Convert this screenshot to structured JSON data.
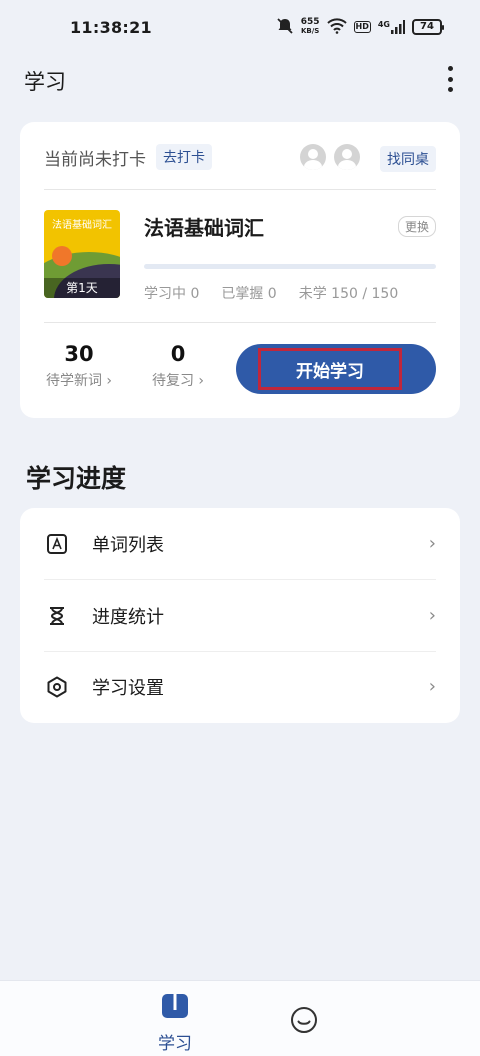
{
  "status_bar": {
    "time": "11:38:21",
    "net_speed_value": "655",
    "net_speed_unit": "KB/S",
    "hd_label": "HD",
    "network_label": "4G",
    "battery": "74"
  },
  "header": {
    "title": "学习"
  },
  "study_card": {
    "checkin_status": "当前尚未打卡",
    "checkin_button": "去打卡",
    "find_buddy_button": "找同桌",
    "book": {
      "cover_title": "法语基础词汇",
      "cover_day": "第1天",
      "name": "法语基础词汇",
      "change_button": "更换",
      "progress_fraction": 0.0
    },
    "stats": {
      "learning": "学习中 0",
      "mastered": "已掌握 0",
      "unlearned": "未学 150 / 150"
    },
    "new_words": {
      "value": "30",
      "label": "待学新词 ›"
    },
    "review_words": {
      "value": "0",
      "label": "待复习 ›"
    },
    "start_button": "开始学习"
  },
  "progress_section": {
    "title": "学习进度",
    "items": [
      {
        "label": "单词列表",
        "icon": "word-list-icon"
      },
      {
        "label": "进度统计",
        "icon": "hourglass-icon"
      },
      {
        "label": "学习设置",
        "icon": "settings-hexagon-icon"
      }
    ],
    "chevron": "›"
  },
  "tab_bar": {
    "tabs": [
      {
        "label": "学习",
        "icon": "book-icon",
        "active": true
      },
      {
        "label": "",
        "icon": "smile-icon",
        "active": false
      }
    ]
  },
  "colors": {
    "accent": "#2f5aa8",
    "background": "#eef1f7",
    "highlight_border": "#c0273c"
  }
}
